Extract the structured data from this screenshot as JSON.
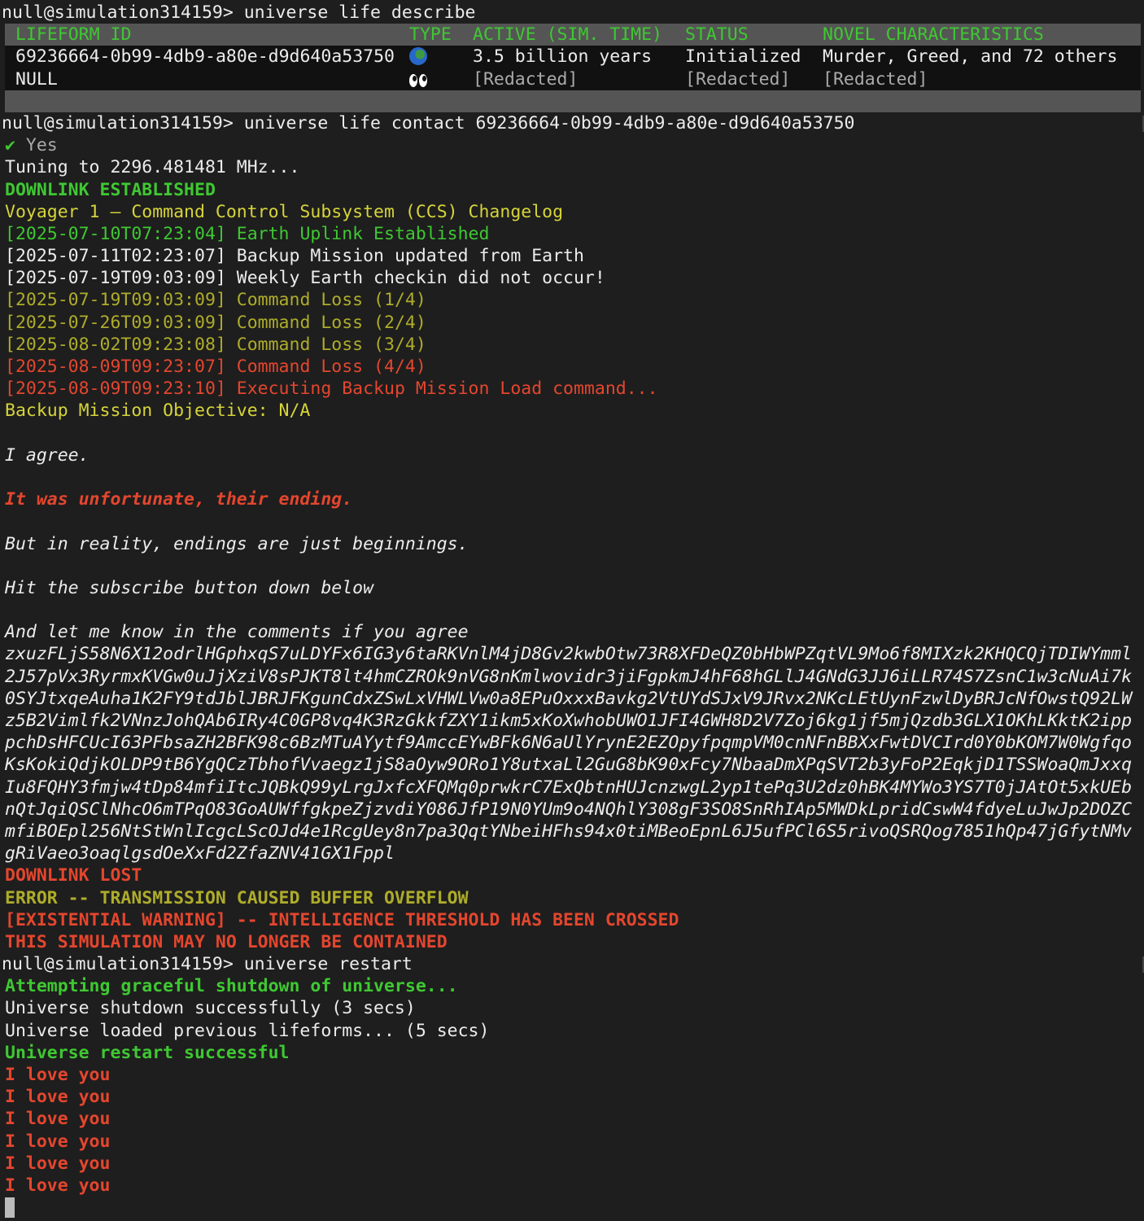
{
  "prompt": "null@simulation314159> ",
  "commands": {
    "describe": "universe life describe",
    "contact": "universe life contact 69236664-0b99-4db9-a80e-d9d640a53750",
    "restart": "universe restart"
  },
  "table": {
    "headers": [
      "LIFEFORM ID",
      "TYPE",
      "ACTIVE (SIM. TIME)",
      "STATUS",
      "NOVEL CHARACTERISTICS"
    ],
    "rows": [
      {
        "id": "69236664-0b99-4db9-a80e-d9d640a53750",
        "type_icon": "globe-icon",
        "active": "3.5 billion years",
        "status": "Initialized",
        "novel": "Murder, Greed, and 72 others"
      },
      {
        "id": "NULL",
        "type_icon": "eyes-icon",
        "active": "[Redacted]",
        "status": "[Redacted]",
        "novel": "[Redacted]"
      }
    ]
  },
  "confirm": {
    "check": "✔",
    "text": " Yes"
  },
  "tuning": "Tuning to 2296.481481 MHz...",
  "downlink_established": "DOWNLINK ESTABLISHED",
  "changelog_title": "Voyager 1 – Command Control Subsystem (CCS) Changelog",
  "log": [
    {
      "ts": "[2025-07-10T07:23:04]",
      "msg": "Earth Uplink Established"
    },
    {
      "ts": "[2025-07-11T02:23:07]",
      "msg": "Backup Mission updated from Earth"
    },
    {
      "ts": "[2025-07-19T09:03:09]",
      "msg": "Weekly Earth checkin did not occur!"
    },
    {
      "ts": "[2025-07-19T09:03:09]",
      "msg": "Command Loss (1/4)"
    },
    {
      "ts": "[2025-07-26T09:03:09]",
      "msg": "Command Loss (2/4)"
    },
    {
      "ts": "[2025-08-02T09:23:08]",
      "msg": "Command Loss (3/4)"
    },
    {
      "ts": "[2025-08-09T09:23:07]",
      "msg": "Command Loss (4/4)"
    },
    {
      "ts": "[2025-08-09T09:23:10]",
      "msg": "Executing Backup Mission Load command..."
    }
  ],
  "objective": "Backup Mission Objective: N/A",
  "message": {
    "agree": "I agree.",
    "unfortunate": "It was unfortunate, their ending.",
    "beginnings": "But in reality, endings are just beginnings.",
    "subscribe": "Hit the subscribe button down below",
    "comments": "And let me know in the comments if you agree"
  },
  "encoded": [
    "zxuzFLjS58N6X12odrlHGphxqS7uLDYFx6IG3y6taRKVnlM4jD8Gv2kwbOtw73R8XFDeQZ0bHbWPZqtVL9Mo6f8MIXzk2KHQCQjTDIWYmml",
    "2J57pVx3RyrmxKVGw0uJjXziV8sPJKT8lt4hmCZROk9nVG8nKmlwovidr3jiFgpkmJ4hF68hGLlJ4GNdG3JJ6iLLR74S7ZsnC1w3cNuAi7k",
    "0SYJtxqeAuha1K2FY9tdJblJBRJFKgunCdxZSwLxVHWLVw0a8EPuOxxxBavkg2VtUYdSJxV9JRvx2NKcLEtUynFzwlDyBRJcNfOwstQ92LW",
    "z5B2Vimlfk2VNnzJohQAb6IRy4C0GP8vq4K3RzGkkfZXY1ikm5xKoXwhobUWO1JFI4GWH8D2V7Zoj6kg1jf5mjQzdb3GLX1OKhLKktK2ipp",
    "pchDsHFCUcI63PFbsaZH2BFK98c6BzMTuAYytf9AmccEYwBFk6N6aUlYrynE2EZOpyfpqmpVM0cnNFnBBXxFwtDVCIrd0Y0bKOM7W0Wgfqo",
    "KsKokiQdjkOLDP9tB6YgQCzTbhofVvaegz1jS8aOyw9ORo1Y8utxaLl2GuG8bK90xFcy7NbaaDmXPqSVT2b3yFoP2EqkjD1TSSWoaQmJxxq",
    "Iu8FQHY3fmjw4tDp84mfiItcJQBkQ99yLrgJxfcXFQMq0prwkrC7ExQbtnHUJcnzwgL2yp1tePq3U2dz0hBK4MYWo3YS7T0jJAtOt5xkUEb",
    "nQtJqiQSClNhcO6mTPqO83GoAUWffgkpeZjzvdiY086JfP19N0YUm9o4NQhlY308gF3SO8SnRhIAp5MWDkLpridCswW4fdyeLuJwJp2DOZC",
    "mfiBOEpl256NtStWnlIcgcLScOJd4e1RcgUey8n7pa3QqtYNbeiHFhs94x0tiMBeoEpnL6J5ufPCl6S5rivoQSRQog7851hQp47jGfytNMv",
    "gRiVaeo3oaqlgsdOeXxFd2ZfaZNV41GX1Fppl"
  ],
  "downlink_lost": "DOWNLINK LOST",
  "error": "ERROR -- TRANSMISSION CAUSED BUFFER OVERFLOW",
  "existential_warning": "[EXISTENTIAL WARNING] -- INTELLIGENCE THRESHOLD HAS BEEN CROSSED",
  "containment": "THIS SIMULATION MAY NO LONGER BE CONTAINED",
  "restart_output": {
    "attempting": "Attempting graceful shutdown of universe...",
    "shutdown": "Universe shutdown successfully (3 secs)",
    "loaded": "Universe loaded previous lifeforms... (5 secs)",
    "success": "Universe restart successful"
  },
  "love_lines": [
    "I love you",
    "I love you",
    "I love you",
    "I love you",
    "I love you",
    "I love you"
  ]
}
